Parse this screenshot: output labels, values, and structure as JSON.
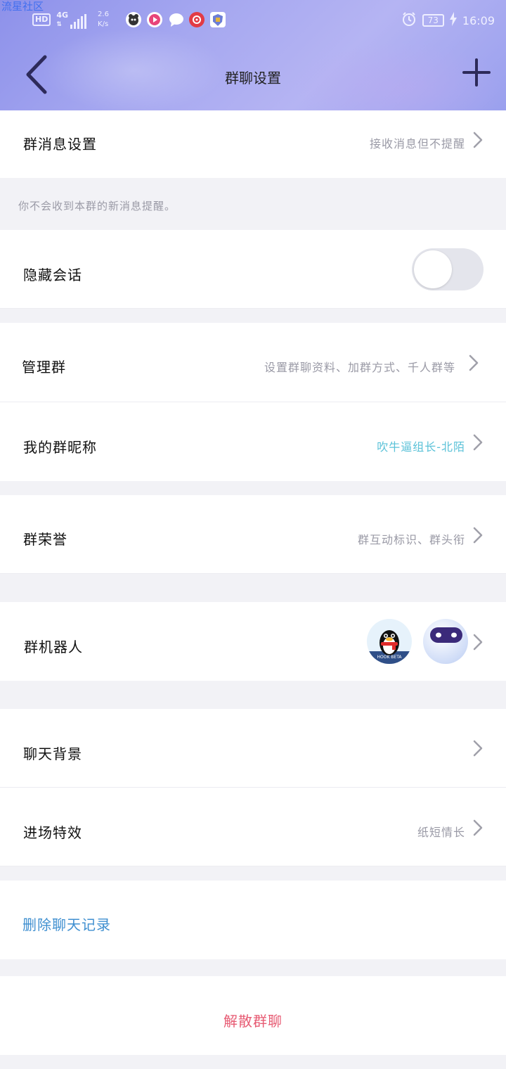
{
  "watermark": "流星社区",
  "status_bar": {
    "hd": "HD",
    "network": "4G",
    "speed_value": "2.6",
    "speed_unit": "K/s",
    "battery": "73",
    "time": "16:09"
  },
  "nav": {
    "title": "群聊设置"
  },
  "message_setting": {
    "label": "群消息设置",
    "value": "接收消息但不提醒"
  },
  "message_note": "你不会收到本群的新消息提醒。",
  "hide_chat": {
    "label": "隐藏会话",
    "enabled": false
  },
  "manage_group": {
    "label": "管理群",
    "value": "设置群聊资料、加群方式、千人群等"
  },
  "my_nickname": {
    "label": "我的群昵称",
    "value": "吹牛逼组长-北陌"
  },
  "group_honor": {
    "label": "群荣誉",
    "value": "群互动标识、群头衔"
  },
  "group_robot": {
    "label": "群机器人",
    "bot1_badge": "HOOK BETA"
  },
  "chat_background": {
    "label": "聊天背景"
  },
  "entry_effect": {
    "label": "进场特效",
    "value": "纸短情长"
  },
  "delete_history": {
    "label": "删除聊天记录"
  },
  "dissolve_group": {
    "label": "解散群聊"
  },
  "colors": {
    "header_gradient_start": "#8d91ea",
    "accent_link": "#3f8fd0",
    "nickname": "#5bc2d8",
    "danger": "#e75b73",
    "muted": "#9a9aa6",
    "background": "#f2f2f6"
  }
}
